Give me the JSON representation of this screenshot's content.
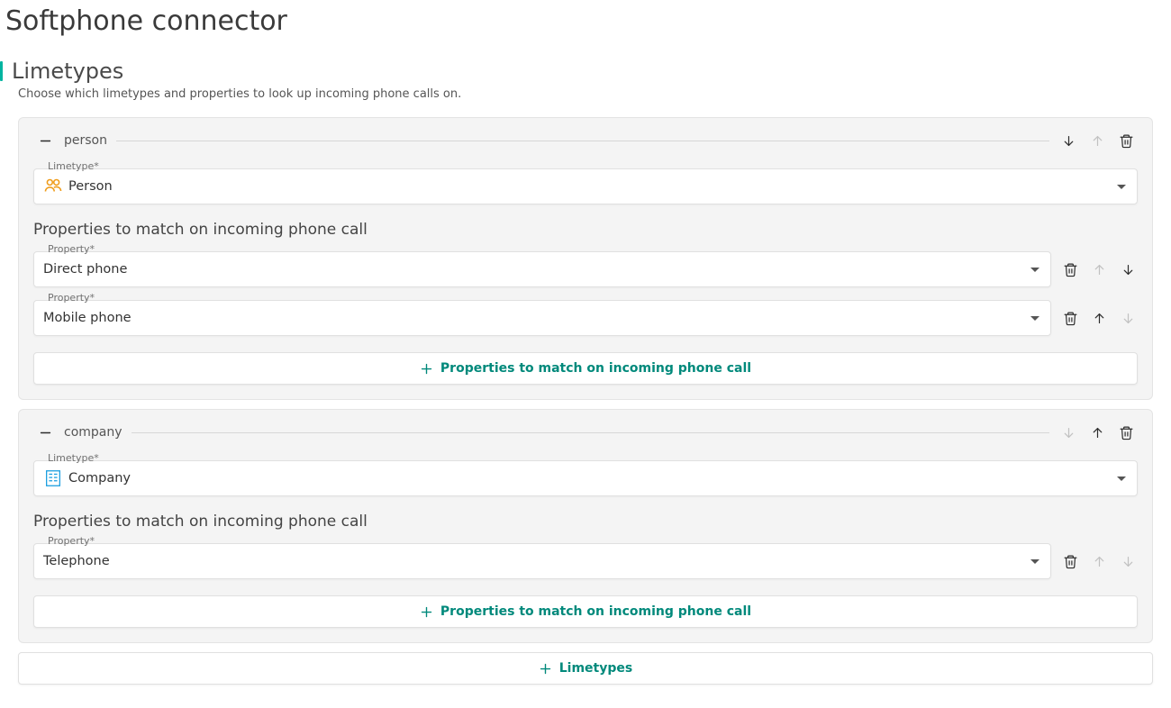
{
  "page_title": "Softphone connector",
  "section": {
    "title": "Limetypes",
    "subtitle": "Choose which limetypes and properties to look up incoming phone calls on."
  },
  "labels": {
    "limetype_field": "Limetype*",
    "property_field": "Property*",
    "properties_heading": "Properties to match on incoming phone call",
    "add_properties": "Properties to match on incoming phone call",
    "add_limetype": "Limetypes"
  },
  "groups": [
    {
      "key": "person",
      "header": "person",
      "limetype_value": "Person",
      "icon": "person",
      "properties": [
        {
          "value": "Direct phone",
          "up_disabled": true,
          "down_disabled": false
        },
        {
          "value": "Mobile phone",
          "up_disabled": false,
          "down_disabled": true
        }
      ],
      "up_disabled": true,
      "down_disabled": false
    },
    {
      "key": "company",
      "header": "company",
      "limetype_value": "Company",
      "icon": "company",
      "properties": [
        {
          "value": "Telephone",
          "up_disabled": true,
          "down_disabled": true
        }
      ],
      "up_disabled": false,
      "down_disabled": true
    }
  ]
}
